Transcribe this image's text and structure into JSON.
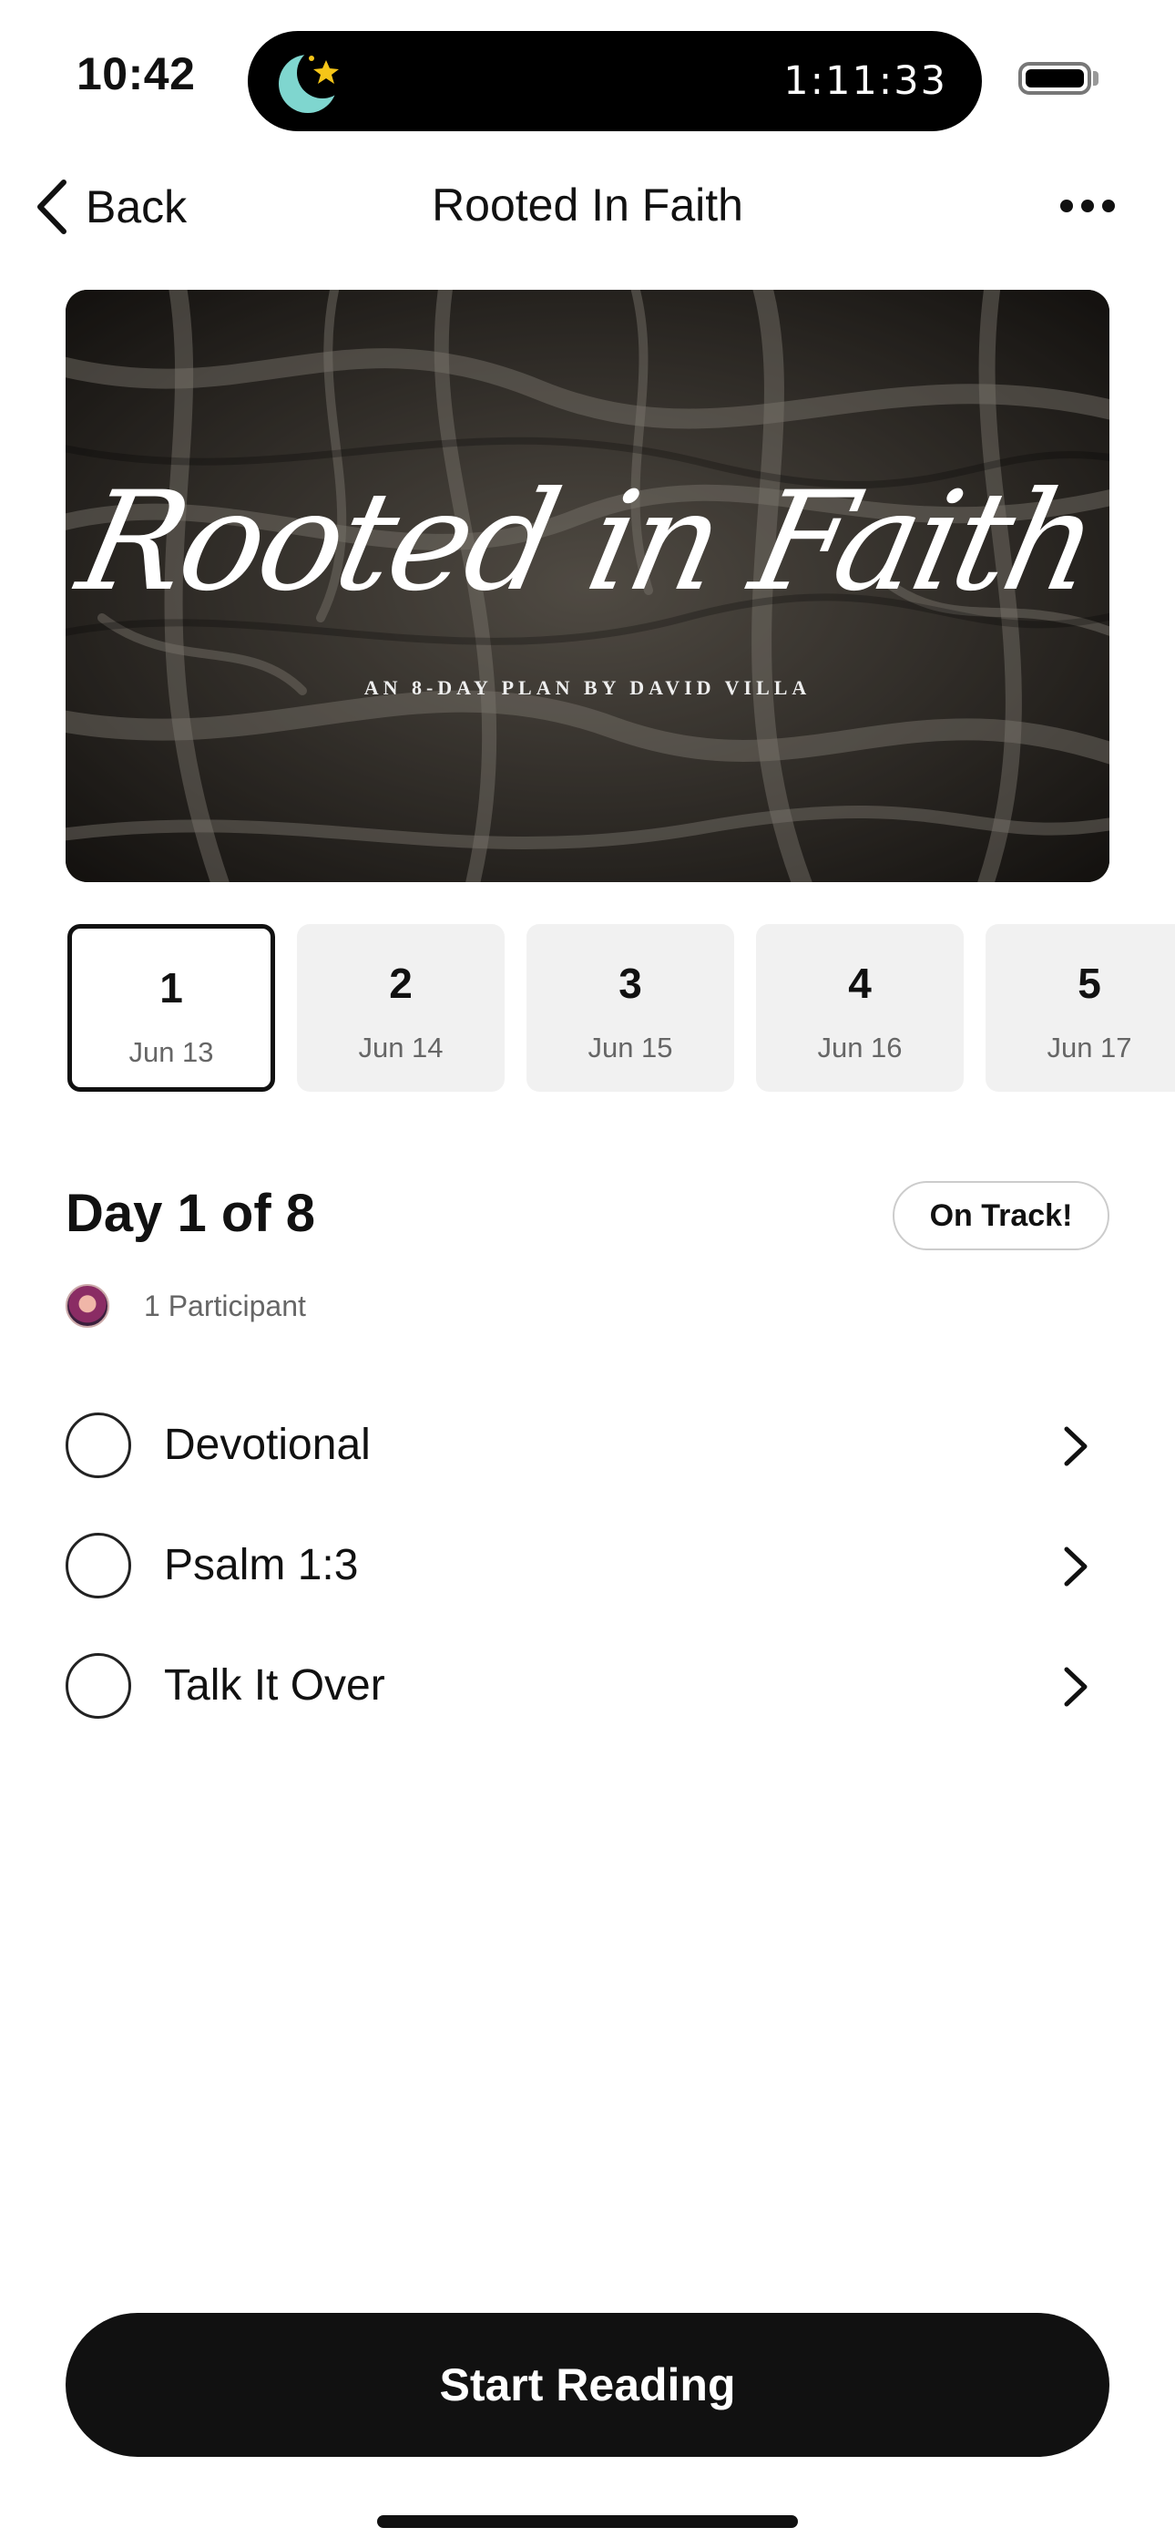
{
  "status_bar": {
    "time": "10:42",
    "island_icon": "moon-star-icon",
    "timer": "1:11:33",
    "battery_icon": "battery-icon"
  },
  "nav": {
    "back_label": "Back",
    "title": "Rooted In Faith",
    "more_icon": "ellipsis-icon"
  },
  "hero": {
    "script_title": "Rooted in Faith",
    "subtitle": "AN 8-DAY PLAN BY DAVID VILLA"
  },
  "days": [
    {
      "num": "1",
      "date": "Jun 13",
      "selected": true
    },
    {
      "num": "2",
      "date": "Jun 14",
      "selected": false
    },
    {
      "num": "3",
      "date": "Jun 15",
      "selected": false
    },
    {
      "num": "4",
      "date": "Jun 16",
      "selected": false
    },
    {
      "num": "5",
      "date": "Jun 17",
      "selected": false
    }
  ],
  "day_info": {
    "heading": "Day 1 of 8",
    "badge": "On Track!",
    "participants": "1 Participant"
  },
  "tasks": [
    {
      "label": "Devotional",
      "completed": false
    },
    {
      "label": "Psalm 1:3",
      "completed": false
    },
    {
      "label": "Talk It Over",
      "completed": false
    }
  ],
  "cta": {
    "label": "Start Reading"
  },
  "colors": {
    "primary": "#111111",
    "chip_bg": "#f1f1f1",
    "muted_text": "#666666"
  }
}
